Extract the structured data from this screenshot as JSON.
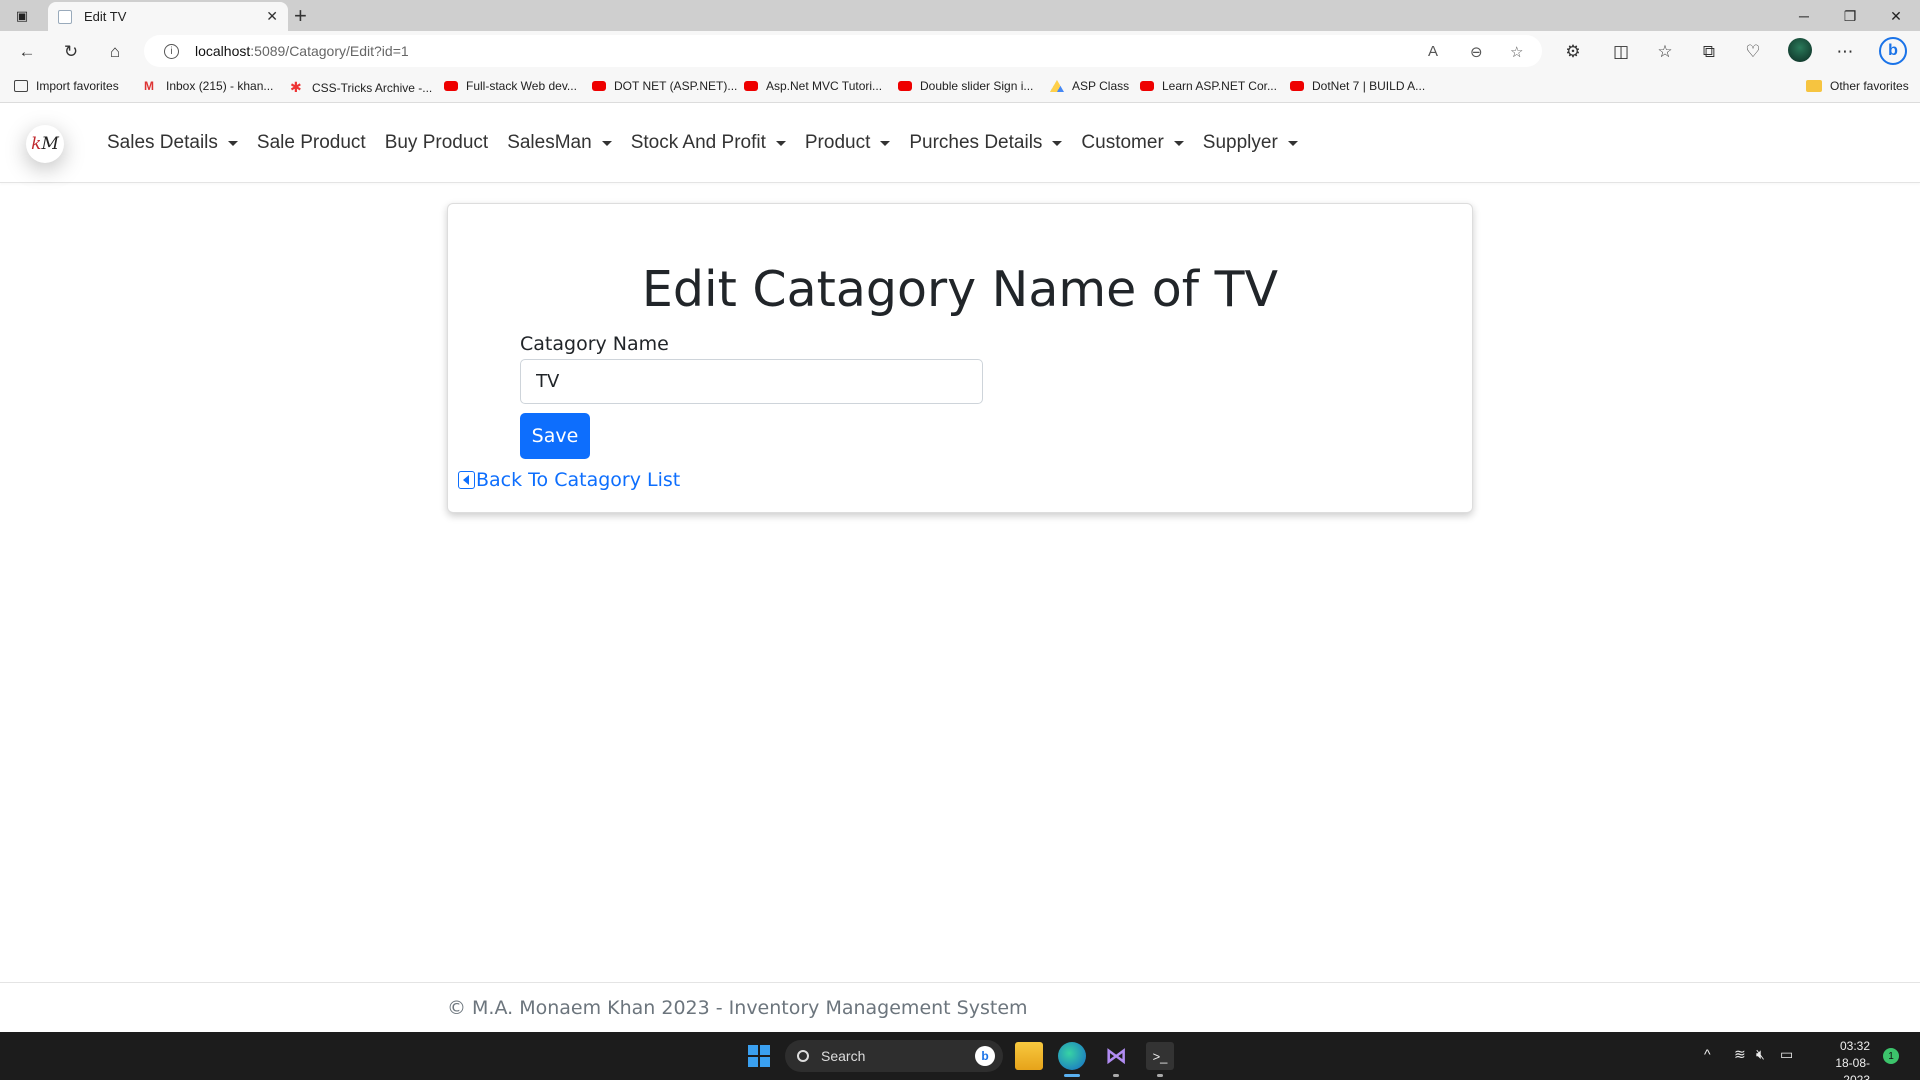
{
  "browser": {
    "tab_title": "Edit TV",
    "tab_close": "✕",
    "new_tab": "+",
    "address_host": "localhost",
    "address_path": ":5089/Catagory/Edit?id=1",
    "favorites": [
      {
        "label": "Import favorites",
        "icon": "import-icon"
      },
      {
        "label": "Inbox (215) - khan...",
        "icon": "gmail-icon"
      },
      {
        "label": "CSS-Tricks Archive -...",
        "icon": "css-tricks-icon"
      },
      {
        "label": "Full-stack Web dev...",
        "icon": "youtube-icon"
      },
      {
        "label": "DOT NET (ASP.NET)...",
        "icon": "youtube-icon"
      },
      {
        "label": "Asp.Net MVC Tutori...",
        "icon": "youtube-icon"
      },
      {
        "label": "Double slider Sign i...",
        "icon": "youtube-icon"
      },
      {
        "label": "ASP Class",
        "icon": "drive-icon"
      },
      {
        "label": "Learn ASP.NET Cor...",
        "icon": "youtube-icon"
      },
      {
        "label": "DotNet 7 | BUILD A...",
        "icon": "youtube-icon"
      }
    ],
    "other_favorites": "Other favorites"
  },
  "navbar": {
    "logo_text_k": "k",
    "logo_text_m": "M",
    "items": [
      {
        "label": "Sales Details",
        "dropdown": true
      },
      {
        "label": "Sale Product",
        "dropdown": false
      },
      {
        "label": "Buy Product",
        "dropdown": false
      },
      {
        "label": "SalesMan",
        "dropdown": true
      },
      {
        "label": "Stock And Profit",
        "dropdown": true
      },
      {
        "label": "Product",
        "dropdown": true
      },
      {
        "label": "Purches Details",
        "dropdown": true
      },
      {
        "label": "Customer",
        "dropdown": true
      },
      {
        "label": "Supplyer",
        "dropdown": true
      }
    ]
  },
  "form": {
    "title": "Edit Catagory Name of TV",
    "field_label": "Catagory Name",
    "field_value": "TV",
    "save_label": "Save",
    "back_label": "Back To Catagory List"
  },
  "footer": {
    "text": "© M.A. Monaem Khan 2023 - Inventory Management System"
  },
  "taskbar": {
    "search_label": "Search",
    "time": "03:32",
    "date": "18-08-2023",
    "notification_count": "1"
  },
  "colors": {
    "primary": "#0d6efd",
    "text": "#212529",
    "muted": "#6c757d"
  }
}
